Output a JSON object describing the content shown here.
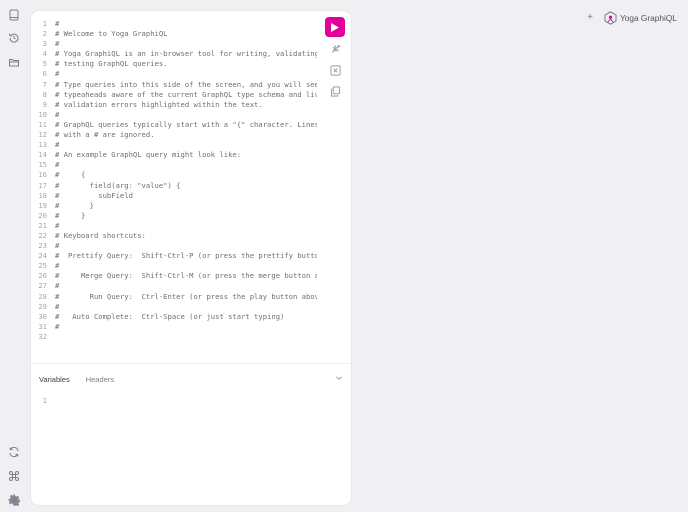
{
  "app": {
    "logo_text": "Yoga GraphiQL",
    "new_tab_label": "+"
  },
  "sidebar": {
    "top_items": [
      {
        "name": "docs-icon"
      },
      {
        "name": "history-icon"
      },
      {
        "name": "explorer-icon"
      }
    ],
    "bottom_items": [
      {
        "name": "refetch-schema-icon"
      },
      {
        "name": "shortcuts-icon"
      },
      {
        "name": "settings-icon"
      }
    ]
  },
  "editor": {
    "lines": [
      "#",
      "# Welcome to Yoga GraphiQL",
      "#",
      "# Yoga GraphiQL is an in-browser tool for writing, validating, and",
      "# testing GraphQL queries.",
      "#",
      "# Type queries into this side of the screen, and you will see intelligent",
      "# typeaheads aware of the current GraphQL type schema and live syntax and",
      "# validation errors highlighted within the text.",
      "#",
      "# GraphQL queries typically start with a \"{\" character. Lines that start",
      "# with a # are ignored.",
      "#",
      "# An example GraphQL query might look like:",
      "#",
      "#     {",
      "#       field(arg: \"value\") {",
      "#         subField",
      "#       }",
      "#     }",
      "#",
      "# Keyboard shortcuts:",
      "#",
      "#  Prettify Query:  Shift-Ctrl-P (or press the prettify button above)",
      "#",
      "#     Merge Query:  Shift-Ctrl-M (or press the merge button above)",
      "#",
      "#       Run Query:  Ctrl-Enter (or press the play button above)",
      "#",
      "#   Auto Complete:  Ctrl-Space (or just start typing)",
      "#",
      ""
    ]
  },
  "toolbar": {
    "run_icon": "play-icon",
    "prettify_icon": "prettify-icon",
    "merge_icon": "merge-icon",
    "copy_icon": "copy-icon"
  },
  "bottom_tabs": {
    "variables_label": "Variables",
    "headers_label": "Headers"
  },
  "variables_editor": {
    "lines": [
      ""
    ]
  },
  "colors": {
    "accent": "#e10098",
    "background": "#f0f0f3",
    "panel": "#ffffff"
  }
}
